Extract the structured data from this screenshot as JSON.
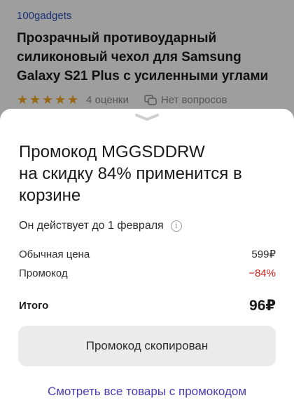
{
  "product": {
    "seller": "100gadgets",
    "title": "Прозрачный противоударный силиконовый чехол для Samsung Galaxy S21 Plus с усиленными углами",
    "rating": 5,
    "reviews": "4 оценки",
    "questions": "Нет вопросов",
    "star_color": "#f5a623"
  },
  "sheet": {
    "title": "Промокод MGGSDDRW\nна скидку 84% применится в корзине",
    "valid_until": "Он действует до 1 февраля",
    "info_icon": "info-icon",
    "price_label": "Обычная цена",
    "price_value": "599₽",
    "promo_label": "Промокод",
    "promo_value": "−84%",
    "promo_color": "#d11a1a",
    "total_label": "Итого",
    "total_value": "96₽",
    "copy_button": "Промокод скопирован",
    "all_link": "Смотреть все товары с промокодом",
    "link_color": "#4a3db5"
  }
}
